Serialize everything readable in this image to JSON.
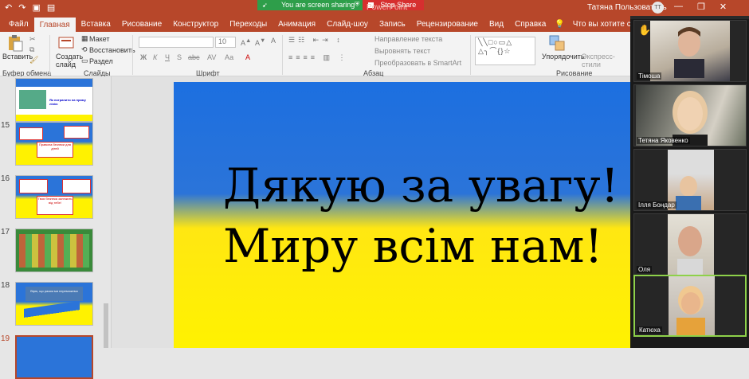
{
  "titlebar": {
    "undo": "↶",
    "redo": "↷",
    "sharing_text": "You are screen sharing",
    "stop_share": "Stop Share",
    "app_title": "PowerPoint",
    "user_name": "Татяна Пользователь",
    "user_initials": "TT",
    "minimize": "—",
    "restore": "❐",
    "close": "✕"
  },
  "tabs": [
    "Файл",
    "Главная",
    "Вставка",
    "Рисование",
    "Конструктор",
    "Переходы",
    "Анимация",
    "Слайд-шоу",
    "Запись",
    "Рецензирование",
    "Вид",
    "Справка"
  ],
  "active_tab": "Главная",
  "tell_me": "Что вы хотите сделать?",
  "ribbon": {
    "paste": "Вставить",
    "clipboard": "Буфер обмена",
    "new_slide": "Создать слайд",
    "layout": "Макет",
    "reset": "Восстановить",
    "section": "Раздел",
    "slides_group": "Слайды",
    "font_size": "10",
    "font_group": "Шрифт",
    "text_direction": "Направление текста",
    "align_text": "Выровнять текст",
    "smartart": "Преобразовать в SmartArt",
    "paragraph_group": "Абзац",
    "arrange": "Упорядочить",
    "quick_styles": "Экспресс-стили",
    "drawing_group": "Рисование",
    "bold": "Ж",
    "italic": "К",
    "underline": "Ч",
    "strike": "S",
    "spacing": "abc",
    "case": "Аа",
    "clear_format": "А"
  },
  "thumbnails": [
    {
      "num": "",
      "caption": "Як потрапити на пряму лінію"
    },
    {
      "num": "15",
      "caption": "Правила безпеки для дітей"
    },
    {
      "num": "16",
      "caption": "Твоя безпека залежить від тебе!"
    },
    {
      "num": "17",
      "caption": ""
    },
    {
      "num": "18",
      "caption": "Вірю, що разом ми переможемо"
    },
    {
      "num": "19",
      "caption": ""
    }
  ],
  "slide": {
    "line1": "Дякую за увагу!",
    "line2": "Миру всім нам!"
  },
  "participants": [
    {
      "name": "Тімоша",
      "hand": "✋"
    },
    {
      "name": "Тетяна Яковенко"
    },
    {
      "name": "Ілля Бондар"
    },
    {
      "name": "Оля"
    },
    {
      "name": "Катюха"
    }
  ],
  "colors": {
    "ppt_red": "#b7472a",
    "share_green": "#2e9e4a",
    "stop_red": "#d62f2f",
    "slide_blue": "#1c6fe0",
    "slide_yellow": "#fff200",
    "active_speaker": "#8ed14a"
  }
}
